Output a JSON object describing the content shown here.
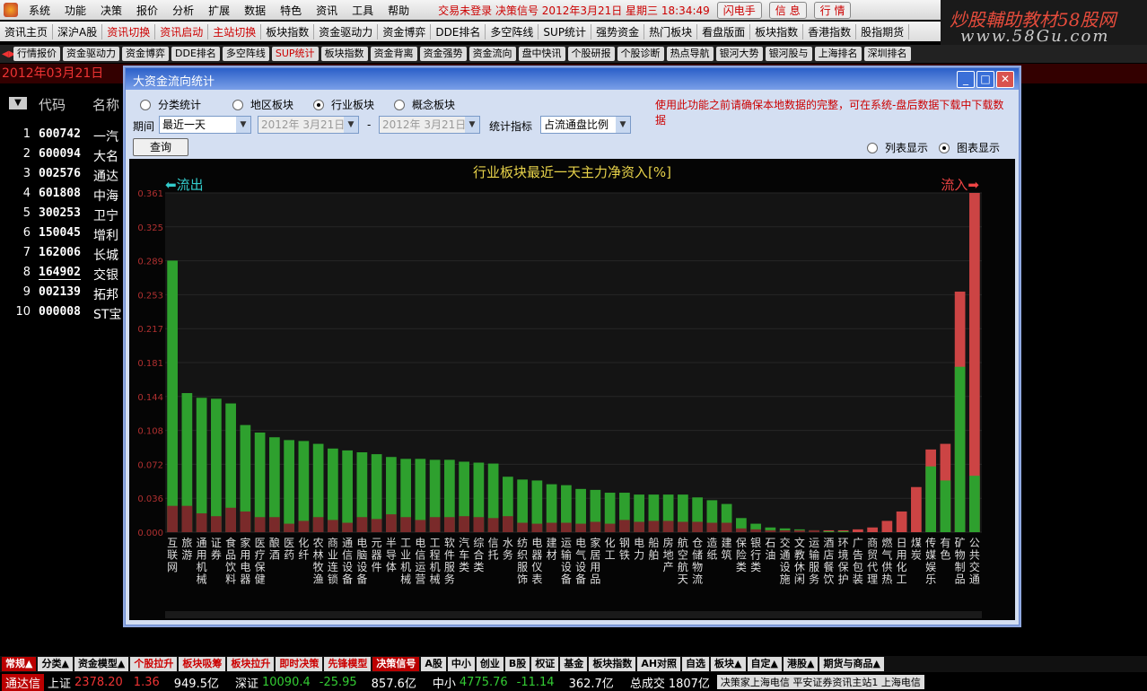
{
  "menubar": {
    "items": [
      "系统",
      "功能",
      "决策",
      "报价",
      "分析",
      "扩展",
      "数据",
      "特色",
      "资讯",
      "工具",
      "帮助"
    ],
    "status": "交易未登录  决策信号  2012年3月21日  星期三  18:34:49",
    "buttons": [
      "闪电手",
      "信 息",
      "行 情"
    ]
  },
  "brand": {
    "line1": "炒股輔助教材",
    "line1_red": "58股网",
    "line2": "www.58Gu.com"
  },
  "toolbar": {
    "items": [
      "资讯主页",
      "深沪A股",
      "资讯切换",
      "资讯启动",
      "主站切换",
      "板块指数",
      "资金驱动力",
      "资金博弈",
      "DDE排名",
      "多空阵线",
      "SUP统计",
      "强势资金",
      "热门板块",
      "看盘版面",
      "板块指数",
      "香港指数",
      "股指期货"
    ]
  },
  "tabbar": {
    "items": [
      "行情报价",
      "资金驱动力",
      "资金博弈",
      "DDE排名",
      "多空阵线",
      "SUP统计",
      "板块指数",
      "资金背离",
      "资金强势",
      "资金流向",
      "盘中快讯",
      "个股研报",
      "个股诊断",
      "热点导航",
      "银河大势",
      "银河股与",
      "上海排名",
      "深圳排名"
    ]
  },
  "date_banner": "2012年03月21日",
  "list": {
    "header_code": "代码",
    "header_name": "名称",
    "rows": [
      {
        "n": "1",
        "code": "600742",
        "name": "一汽"
      },
      {
        "n": "2",
        "code": "600094",
        "name": "大名"
      },
      {
        "n": "3",
        "code": "002576",
        "name": "通达"
      },
      {
        "n": "4",
        "code": "601808",
        "name": "中海"
      },
      {
        "n": "5",
        "code": "300253",
        "name": "卫宁"
      },
      {
        "n": "6",
        "code": "150045",
        "name": "增利"
      },
      {
        "n": "7",
        "code": "162006",
        "name": "长城"
      },
      {
        "n": "8",
        "code": "164902",
        "name": "交银"
      },
      {
        "n": "9",
        "code": "002139",
        "name": "拓邦"
      },
      {
        "n": "10",
        "code": "000008",
        "name": "ST宝"
      }
    ]
  },
  "dialog": {
    "title": "大资金流向统计",
    "radios": [
      "分类统计",
      "地区板块",
      "行业板块",
      "概念板块"
    ],
    "selected_radio": "行业板块",
    "warning": "使用此功能之前请确保本地数据的完整，可在系统-盘后数据下载中下载数据",
    "period_label": "期间",
    "period_value": "最近一天",
    "date_from": "2012年 3月21日",
    "date_to": "2012年 3月21日",
    "dash": "-",
    "metric_label": "统计指标",
    "metric_value": "占流通盘比例",
    "query_button": "查询",
    "view_list": "列表显示",
    "view_chart": "图表显示"
  },
  "chart_data": {
    "type": "bar",
    "title": "行业板块最近一天主力净资入[%]",
    "flow_out": "流出",
    "flow_in": "流入",
    "ylim": [
      0,
      0.361
    ],
    "y_ticks": [
      "0.000",
      "0.036",
      "0.072",
      "0.108",
      "0.144",
      "0.181",
      "0.217",
      "0.253",
      "0.289",
      "0.325",
      "0.361"
    ],
    "categories": [
      "互联网",
      "旅游",
      "通用机械",
      "证券",
      "食品饮料",
      "家用电器",
      "医疗保健",
      "酿酒",
      "医药",
      "化纤",
      "农林牧渔",
      "商业连锁",
      "通信设备",
      "电脑设备",
      "元器件",
      "半导体",
      "工业机械",
      "电信运营",
      "工程机械",
      "软件服务",
      "汽车类",
      "综合类",
      "信托",
      "水务",
      "纺织服饰",
      "电器仪表",
      "建材",
      "运输设备",
      "电气设备",
      "家居用品",
      "化工",
      "钢铁",
      "电力",
      "船舶",
      "房地产",
      "航空航天",
      "仓储物流",
      "造纸",
      "建筑",
      "保险类",
      "银行类",
      "石油",
      "交通设施",
      "文教休闲",
      "运输服务",
      "酒店餐饮",
      "环境保护",
      "广告包装",
      "商贸代理",
      "燃气供热",
      "日用化工",
      "煤炭",
      "传媒娱乐",
      "有色",
      "矿物制品",
      "公共交通"
    ],
    "series": [
      {
        "name": "outflow",
        "color": "#2ea02e",
        "values": [
          0.289,
          0.148,
          0.143,
          0.142,
          0.137,
          0.114,
          0.106,
          0.101,
          0.098,
          0.097,
          0.094,
          0.089,
          0.087,
          0.085,
          0.083,
          0.08,
          0.078,
          0.078,
          0.077,
          0.077,
          0.075,
          0.074,
          0.073,
          0.059,
          0.056,
          0.055,
          0.051,
          0.05,
          0.046,
          0.045,
          0.042,
          0.042,
          0.04,
          0.04,
          0.04,
          0.04,
          0.037,
          0.034,
          0.03,
          0.015,
          0.009,
          0.005,
          0.004,
          0.003,
          0.002,
          0.001,
          0.001,
          0.0,
          0.0,
          0.0,
          0.0,
          0.0,
          0.07,
          0.055,
          0.176,
          0.06
        ]
      },
      {
        "name": "inflow",
        "color": "#c44",
        "values": [
          0.028,
          0.028,
          0.02,
          0.017,
          0.026,
          0.022,
          0.016,
          0.016,
          0.009,
          0.012,
          0.016,
          0.013,
          0.01,
          0.016,
          0.014,
          0.019,
          0.016,
          0.013,
          0.016,
          0.016,
          0.017,
          0.016,
          0.015,
          0.017,
          0.01,
          0.009,
          0.01,
          0.01,
          0.009,
          0.011,
          0.009,
          0.013,
          0.011,
          0.012,
          0.012,
          0.011,
          0.011,
          0.01,
          0.01,
          0.004,
          0.003,
          0.002,
          0.002,
          0.002,
          0.002,
          0.002,
          0.002,
          0.003,
          0.005,
          0.012,
          0.022,
          0.048,
          0.088,
          0.094,
          0.256,
          0.361
        ]
      }
    ]
  },
  "statusbar1": {
    "items": [
      "常规▲",
      "分类▲",
      "资金模型▲",
      "个股拉升",
      "板块吸筹",
      "板块拉升",
      "即时决策",
      "先锋模型",
      "决策信号",
      "A股",
      "中小",
      "创业",
      "B股",
      "权证",
      "基金",
      "板块指数",
      "AH对照",
      "自选",
      "板块▲",
      "自定▲",
      "港股▲",
      "期货与商品▲"
    ]
  },
  "statusbar2": {
    "brand": "通达信",
    "sh_label": "上证",
    "sh_val": "2378.20",
    "sh_chg": "1.36",
    "sh_amt": "949.5亿",
    "sz_label": "深证",
    "sz_val": "10090.4",
    "sz_chg": "-25.95",
    "sz_amt": "857.6亿",
    "zx_label": "中小",
    "zx_val": "4775.76",
    "zx_chg": "-11.14",
    "zx_amt": "362.7亿",
    "total_label": "总成交",
    "total_val": "1807亿",
    "info": "决策家上海电信  平安证券资讯主站1  上海电信"
  }
}
